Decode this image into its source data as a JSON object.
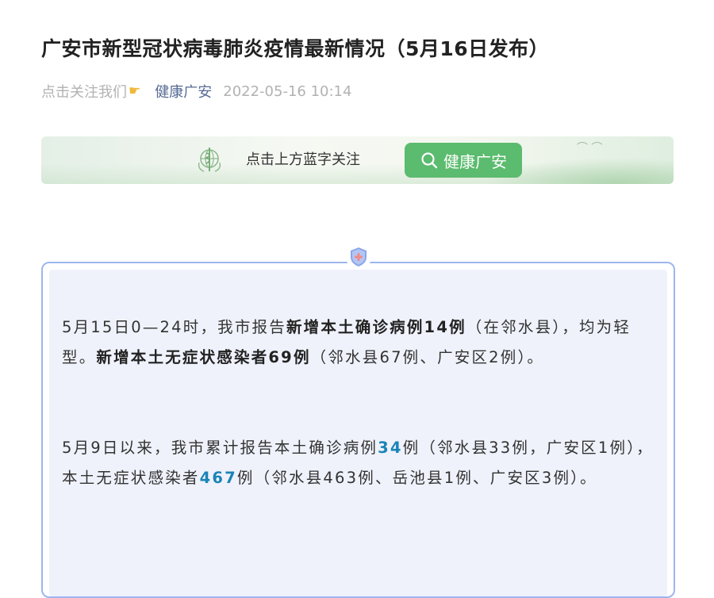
{
  "article": {
    "title": "广安市新型冠状病毒肺炎疫情最新情况（5月16日发布）",
    "follow_text": "点击关注我们",
    "account_name": "健康广安",
    "publish_time": "2022-05-16 10:14"
  },
  "banner": {
    "hint": "点击上方蓝字关注",
    "button_label": "健康广安",
    "button_color": "#5bbb6e"
  },
  "content": {
    "para1": {
      "t1": "5月15日0—24时，我市报告",
      "b1": "新增本土确诊病例14例",
      "t2": "（在邻水县），均为轻型。",
      "b2": "新增本土无症状感染者69例",
      "t3": "（邻水县67例、广安区2例）。"
    },
    "para2": {
      "t1": "5月9日以来，我市累计报告本土确诊病例",
      "n1": "34",
      "t2": "例（邻水县33例，广安区1例），本土无症状感染者",
      "n2": "467",
      "t3": "例（邻水县463例、岳池县1例、广安区3例）。"
    },
    "highlight_color": "#1a84b6"
  },
  "icons": {
    "hand": "pointing-hand-icon",
    "emblem": "who-emblem-icon",
    "search": "search-icon",
    "shield": "medical-shield-icon"
  }
}
